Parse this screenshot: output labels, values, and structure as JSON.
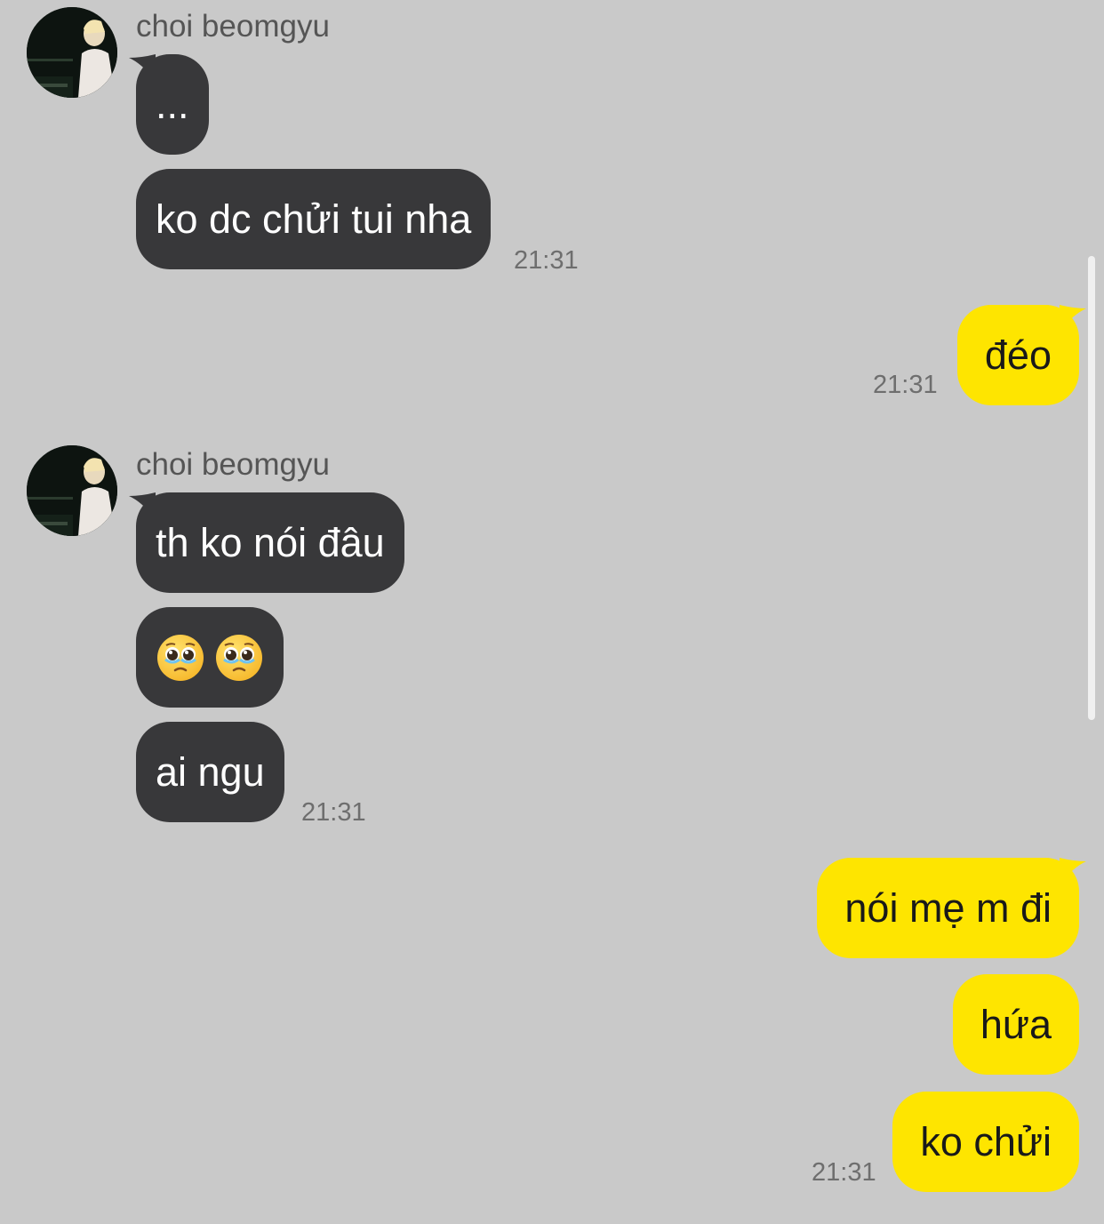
{
  "conversation": {
    "contact_name": "choi beomgyu",
    "groups": [
      {
        "sender": "choi beomgyu",
        "direction": "incoming",
        "avatar_icon": "profile-photo",
        "messages": [
          "...",
          "ko dc chửi tui nha"
        ],
        "time": "21:31"
      },
      {
        "sender": "me",
        "direction": "outgoing",
        "messages": [
          "đéo"
        ],
        "time": "21:31"
      },
      {
        "sender": "choi beomgyu",
        "direction": "incoming",
        "avatar_icon": "profile-photo",
        "messages": [
          "th ko nói đâu",
          "🥹🥹",
          "ai ngu"
        ],
        "time": "21:31"
      },
      {
        "sender": "me",
        "direction": "outgoing",
        "messages": [
          "nói mẹ m đi",
          "hứa",
          "ko chửi"
        ],
        "time": "21:31"
      }
    ]
  },
  "emoji": {
    "name": "face-holding-back-tears-icon",
    "count": 2
  },
  "colors": {
    "background": "#c9c9c9",
    "incoming_bubble": "#38383a",
    "incoming_text": "#ffffff",
    "outgoing_bubble": "#fee500",
    "outgoing_text": "#191919",
    "timestamp": "#6e6e6e",
    "sender_name": "#555555"
  }
}
